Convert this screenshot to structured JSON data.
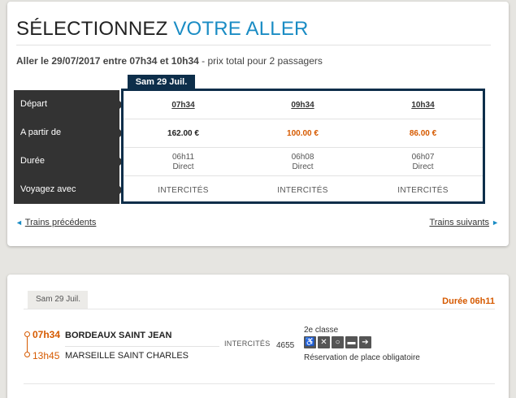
{
  "selection": {
    "title_main": "SÉLECTIONNEZ",
    "title_accent": "VOTRE ALLER",
    "subtitle_bold": "Aller le 29/07/2017 entre 07h34 et 10h34",
    "subtitle_rest": " - prix total pour 2 passagers",
    "date_tab": "Sam 29 Juil.",
    "row_labels": [
      "Départ",
      "A partir de",
      "Durée",
      "Voyagez avec"
    ],
    "trains": [
      {
        "departure": "07h34",
        "price": "162.00 €",
        "price_color": "#222222",
        "duration": "06h11",
        "type": "Direct",
        "operator": "INTERCITÉS"
      },
      {
        "departure": "09h34",
        "price": "100.00 €",
        "price_color": "#d65a00",
        "duration": "06h08",
        "type": "Direct",
        "operator": "INTERCITÉS"
      },
      {
        "departure": "10h34",
        "price": "86.00 €",
        "price_color": "#d65a00",
        "duration": "06h07",
        "type": "Direct",
        "operator": "INTERCITÉS"
      }
    ],
    "prev_label": "Trains précédents",
    "next_label": "Trains suivants",
    "prev_icon": "arrow-left-icon",
    "next_icon": "arrow-right-icon"
  },
  "detail": {
    "date_tab": "Sam 29 Juil.",
    "duration": "Durée  06h11",
    "departure_time": "07h34",
    "departure_station": "BORDEAUX SAINT JEAN",
    "arrival_time": "13h45",
    "arrival_station": "MARSEILLE SAINT CHARLES",
    "operator": "INTERCITÉS",
    "train_number": "4655",
    "class": "2e classe",
    "amenities": [
      "wheelchair-icon",
      "restaurant-icon",
      "bike-icon",
      "couchette-icon",
      "direction-icon"
    ],
    "reservation": "Réservation de place obligatoire"
  },
  "colors": {
    "accent": "#1a8cc4",
    "navy": "#0d2e4a",
    "orange": "#d65a00"
  }
}
